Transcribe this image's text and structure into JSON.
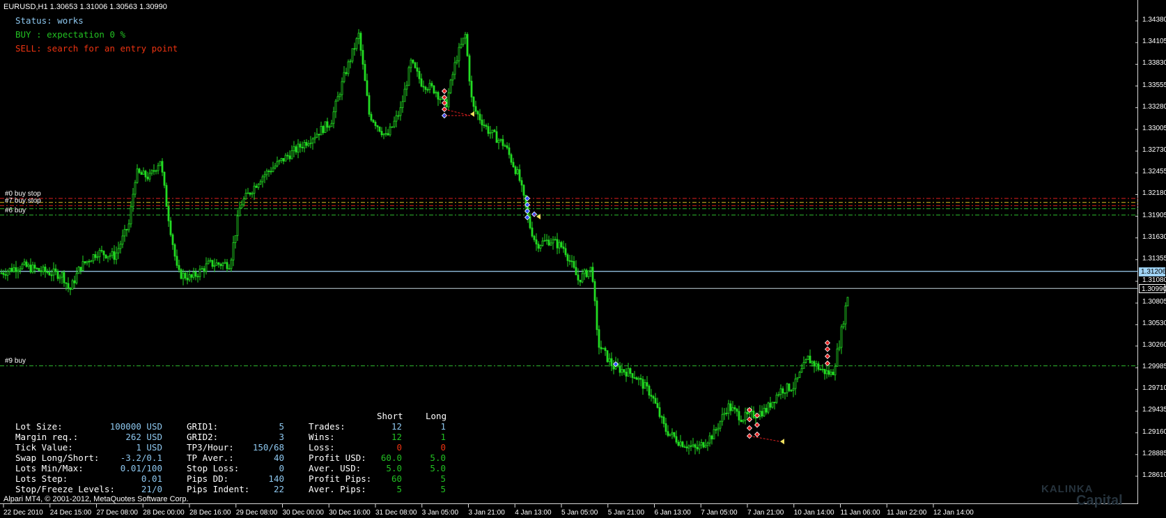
{
  "header": {
    "symbol": "EURUSD,H1",
    "ohlc": "1.30653 1.31006 1.30563 1.30990"
  },
  "status_lines": [
    {
      "text": "Status: works",
      "color": "#8ec8f0"
    },
    {
      "text": "BUY : expectation 0 %",
      "color": "#22c022"
    },
    {
      "text": "SELL: search for an entry point",
      "color": "#ee3311"
    }
  ],
  "price_axis": {
    "ticks": [
      "1.34380",
      "1.34105",
      "1.33830",
      "1.33555",
      "1.33280",
      "1.33005",
      "1.32730",
      "1.32455",
      "1.32180",
      "1.31905",
      "1.31630",
      "1.31355",
      "1.31080",
      "1.30805",
      "1.30530",
      "1.30260",
      "1.29985",
      "1.29710",
      "1.29435",
      "1.29160",
      "1.28885",
      "1.28610"
    ],
    "max": 1.3438,
    "min": 1.2861,
    "bid_tag": "1.30990",
    "ask_tag": "1.31206"
  },
  "time_axis": {
    "labels": [
      "22 Dec 2010",
      "24 Dec 15:00",
      "27 Dec 08:00",
      "28 Dec 00:00",
      "28 Dec 16:00",
      "29 Dec 08:00",
      "30 Dec 00:00",
      "30 Dec 16:00",
      "31 Dec 08:00",
      "3 Jan 05:00",
      "3 Jan 21:00",
      "4 Jan 13:00",
      "5 Jan 05:00",
      "5 Jan 21:00",
      "6 Jan 13:00",
      "7 Jan 05:00",
      "7 Jan 21:00",
      "10 Jan 14:00",
      "11 Jan 06:00",
      "11 Jan 22:00",
      "12 Jan 14:00"
    ]
  },
  "order_lines": [
    {
      "label": "#0 buy stop",
      "price": 1.3213,
      "color": "#e02020",
      "show_label": true
    },
    {
      "label": "",
      "price": 1.3208,
      "color": "#e0c020",
      "show_label": false
    },
    {
      "label": "#7 buy stop",
      "price": 1.3204,
      "color": "#e02020",
      "show_label": true
    },
    {
      "label": "",
      "price": 1.32,
      "color": "#30c030",
      "show_label": false
    },
    {
      "label": "#6 buy",
      "price": 1.3192,
      "color": "#30c030",
      "show_label": true
    },
    {
      "label": "#9 buy",
      "price": 1.3001,
      "color": "#30c030",
      "show_label": true
    }
  ],
  "price_lines": {
    "ask": {
      "price": 1.31206,
      "color": "#9fd3f5"
    },
    "bid": {
      "price": 1.3099,
      "color": "#c8d8e0"
    }
  },
  "chart_data": {
    "type": "candlestick",
    "symbol": "EURUSD",
    "timeframe": "H1",
    "ylim": [
      1.2861,
      1.3438
    ],
    "close_path": [
      [
        0,
        1.3118
      ],
      [
        30,
        1.3128
      ],
      [
        60,
        1.3121
      ],
      [
        90,
        1.3116
      ],
      [
        100,
        1.3096
      ],
      [
        115,
        1.3126
      ],
      [
        140,
        1.3145
      ],
      [
        165,
        1.314
      ],
      [
        185,
        1.318
      ],
      [
        195,
        1.3245
      ],
      [
        215,
        1.324
      ],
      [
        230,
        1.3262
      ],
      [
        240,
        1.32
      ],
      [
        255,
        1.3118
      ],
      [
        275,
        1.3112
      ],
      [
        300,
        1.313
      ],
      [
        330,
        1.313
      ],
      [
        345,
        1.3205
      ],
      [
        375,
        1.324
      ],
      [
        410,
        1.3265
      ],
      [
        440,
        1.3285
      ],
      [
        475,
        1.331
      ],
      [
        495,
        1.337
      ],
      [
        515,
        1.342
      ],
      [
        530,
        1.332
      ],
      [
        555,
        1.329
      ],
      [
        575,
        1.3325
      ],
      [
        590,
        1.3385
      ],
      [
        605,
        1.336
      ],
      [
        625,
        1.335
      ],
      [
        640,
        1.333
      ],
      [
        655,
        1.339
      ],
      [
        668,
        1.342
      ],
      [
        678,
        1.333
      ],
      [
        700,
        1.33
      ],
      [
        725,
        1.328
      ],
      [
        745,
        1.324
      ],
      [
        760,
        1.318
      ],
      [
        770,
        1.3155
      ],
      [
        790,
        1.316
      ],
      [
        810,
        1.315
      ],
      [
        830,
        1.311
      ],
      [
        850,
        1.3125
      ],
      [
        858,
        1.303
      ],
      [
        880,
        1.3
      ],
      [
        910,
        1.299
      ],
      [
        935,
        1.2965
      ],
      [
        955,
        1.292
      ],
      [
        975,
        1.2905
      ],
      [
        1000,
        1.2895
      ],
      [
        1025,
        1.2915
      ],
      [
        1045,
        1.295
      ],
      [
        1065,
        1.2935
      ],
      [
        1085,
        1.294
      ],
      [
        1100,
        1.2945
      ],
      [
        1120,
        1.297
      ],
      [
        1140,
        1.2975
      ],
      [
        1160,
        1.301
      ],
      [
        1180,
        1.2995
      ],
      [
        1195,
        1.299
      ],
      [
        1205,
        1.303
      ],
      [
        1218,
        1.3095
      ]
    ],
    "last": {
      "open": 1.30653,
      "high": 1.31006,
      "low": 1.30563,
      "close": 1.3099
    }
  },
  "stats": {
    "col1": [
      {
        "label": "Lot Size:",
        "value": "100000 USD"
      },
      {
        "label": "Margin req.:",
        "value": "262 USD"
      },
      {
        "label": "Tick Value:",
        "value": "1 USD"
      },
      {
        "label": "Swap Long/Short:",
        "value": "-3.2/0.1"
      },
      {
        "label": "Lots Min/Max:",
        "value": "0.01/100"
      },
      {
        "label": "Lots Step:",
        "value": "0.01"
      },
      {
        "label": "Stop/Freeze Levels:",
        "value": "21/0"
      }
    ],
    "col2": [
      {
        "label": "GRID1:",
        "value": "5"
      },
      {
        "label": "GRID2:",
        "value": "3"
      },
      {
        "label": "TP3/Hour:",
        "value": "150/68"
      },
      {
        "label": "TP Aver.:",
        "value": "40"
      },
      {
        "label": "Stop Loss:",
        "value": "0"
      },
      {
        "label": "Pips DD:",
        "value": "140"
      },
      {
        "label": "Pips Indent:",
        "value": "22"
      }
    ],
    "col3_header": {
      "short": "Short",
      "long": "Long"
    },
    "col3": [
      {
        "label": "Trades:",
        "short": "12",
        "long": "1",
        "color": "#8ec8f0"
      },
      {
        "label": "Wins:",
        "short": "12",
        "long": "1",
        "color": "#22c022"
      },
      {
        "label": "Loss:",
        "short": "0",
        "long": "0",
        "color": "#ee3311"
      },
      {
        "label": "Profit USD:",
        "short": "60.0",
        "long": "5.0",
        "color": "#22c022"
      },
      {
        "label": "Aver. USD:",
        "short": "5.0",
        "long": "5.0",
        "color": "#22c022"
      },
      {
        "label": "Profit Pips:",
        "short": "60",
        "long": "5",
        "color": "#22c022"
      },
      {
        "label": "Aver. Pips:",
        "short": "5",
        "long": "5",
        "color": "#22c022"
      }
    ]
  },
  "footer": {
    "copyright": "Alpari MT4, © 2001-2012, MetaQuotes Software Corp."
  },
  "watermark": {
    "line1": "KALINKA",
    "line2": "Capital"
  },
  "colors": {
    "candle": "#22dd22",
    "label_white": "#ffffff",
    "value_blue": "#8ec8f0",
    "grid_border": "#d9d9d9"
  }
}
